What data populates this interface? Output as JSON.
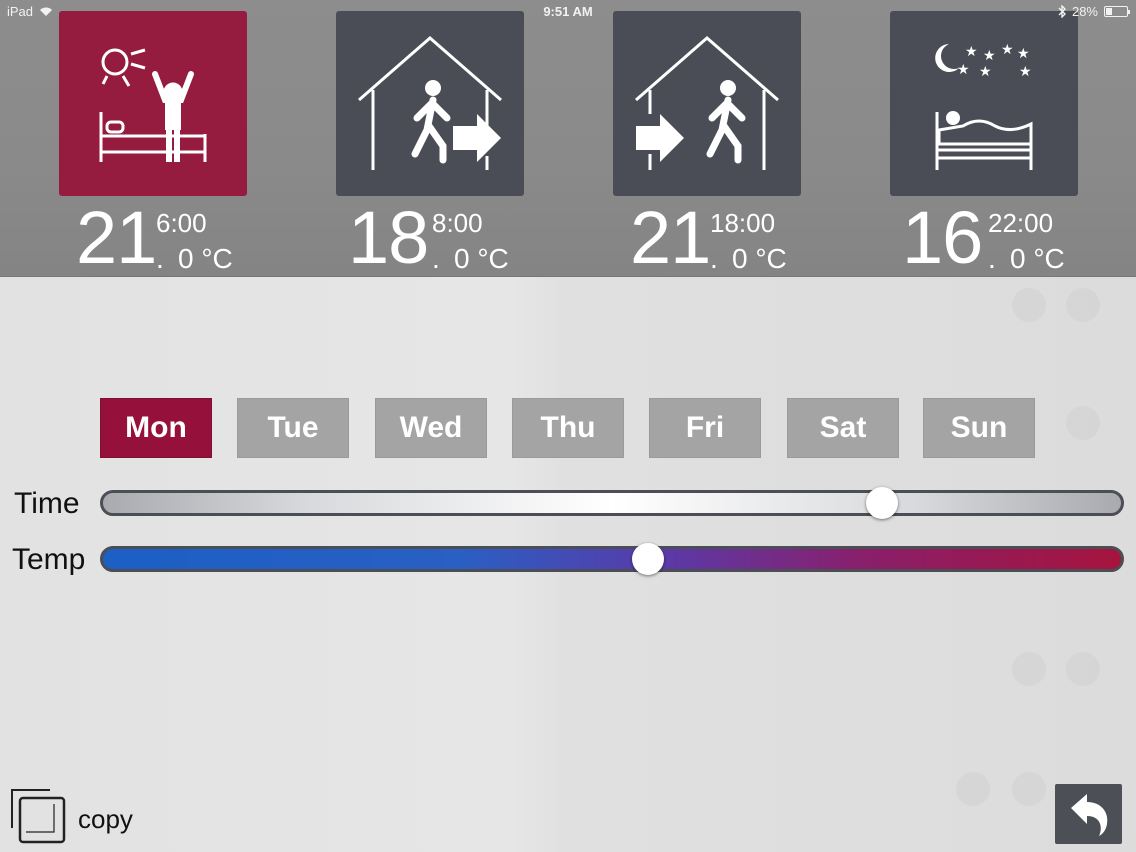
{
  "status_bar": {
    "device": "iPad",
    "time": "9:51 AM",
    "battery": "28%"
  },
  "modes": [
    {
      "name": "wake",
      "temp": "21",
      "time": "6:00",
      "decimal": ".",
      "unit": "0 °C",
      "icon": "wake-up-icon",
      "active": true
    },
    {
      "name": "leave",
      "temp": "18",
      "time": "8:00",
      "decimal": ".",
      "unit": "0 °C",
      "icon": "leave-home-icon",
      "active": false
    },
    {
      "name": "return",
      "temp": "21",
      "time": "18:00",
      "decimal": ".",
      "unit": "0 °C",
      "icon": "return-home-icon",
      "active": false
    },
    {
      "name": "sleep",
      "temp": "16",
      "time": "22:00",
      "decimal": ".",
      "unit": "0 °C",
      "icon": "sleep-icon",
      "active": false
    }
  ],
  "days": [
    "Mon",
    "Tue",
    "Wed",
    "Thu",
    "Fri",
    "Sat",
    "Sun"
  ],
  "selected_day": "Mon",
  "sliders": {
    "time_label": "Time",
    "temp_label": "Temp",
    "time_value": 0.765,
    "temp_value": 0.535
  },
  "controls": {
    "copy_label": "copy",
    "back": "back-arrow-icon"
  },
  "colors": {
    "accent": "#951b3f",
    "tile": "#4a4d55",
    "day_inactive": "#a4a4a4"
  }
}
